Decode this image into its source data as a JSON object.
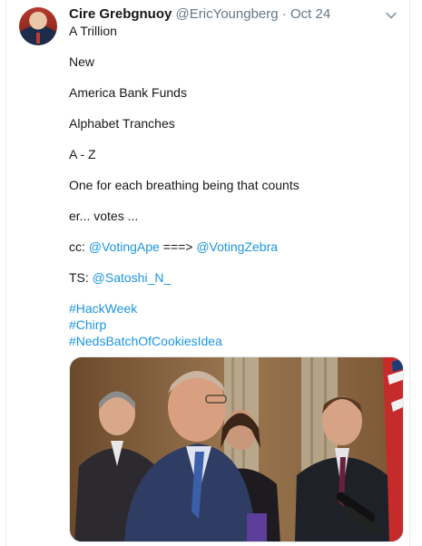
{
  "tweet": {
    "display_name": "Cire Grebgnuoy",
    "handle": "@EricYoungberg",
    "separator": "·",
    "date": "Oct 24",
    "lines": {
      "l1": "A Trillion",
      "l2": "New",
      "l3": "America Bank Funds",
      "l4": "Alphabet Tranches",
      "l5": "A - Z",
      "l6": "One for each breathing being that counts",
      "l7": "er... votes ..."
    },
    "cc": {
      "prefix": "cc: ",
      "mention1": "@VotingApe",
      "arrow": " ===> ",
      "mention2": "@VotingZebra"
    },
    "ts": {
      "prefix": "TS: ",
      "mention": "@Satoshi_N_"
    },
    "hashtags": [
      "#HackWeek",
      "#Chirp",
      "#NedsBatchOfCookiesIdea"
    ]
  },
  "icons": {
    "avatar": "profile-photo",
    "menu": "chevron-down-icon",
    "media": "news-photo"
  },
  "colors": {
    "link": "#1b95e0",
    "muted": "#657786",
    "text": "#14171a",
    "border": "#e1e8ed"
  }
}
